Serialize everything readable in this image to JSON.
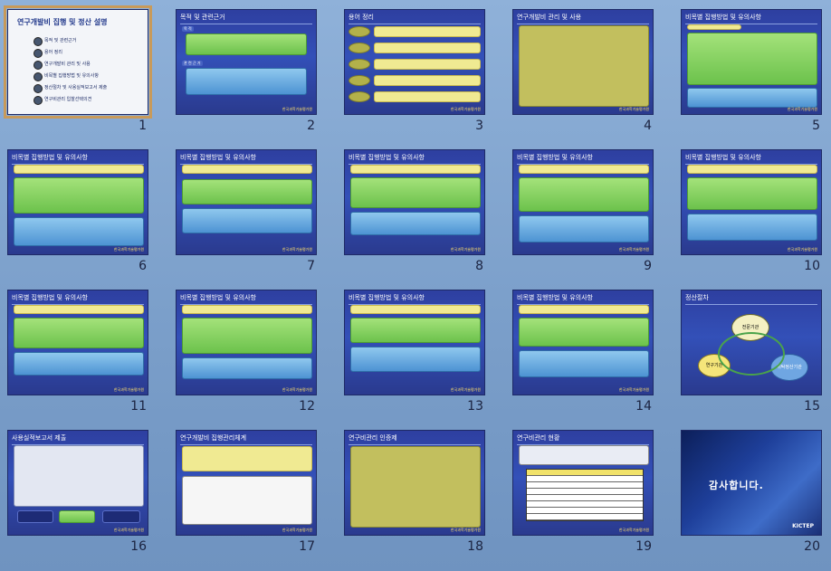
{
  "footer_text": "한국과학기술평가원",
  "slides": [
    {
      "number": "1",
      "title": "연구개발비 집행 및 정산 설명",
      "items": [
        "목적 및 관련근거",
        "용어 정리",
        "연구개발비 관리 및 사용",
        "비목별 집행방법 및 유의사항",
        "정산절차 및 사용실적보고서 제출",
        "연구비관리 입찰선택의견"
      ]
    },
    {
      "number": "2",
      "title": "목적 및 관련근거",
      "heading1": "목 적",
      "heading2": "관 련 근 거"
    },
    {
      "number": "3",
      "title": "용어 정리"
    },
    {
      "number": "4",
      "title": "연구개발비 관리 및 사용"
    },
    {
      "number": "5",
      "title": "비목별 집행방법 및 유의사항"
    },
    {
      "number": "6",
      "title": "비목별 집행방법 및 유의사항"
    },
    {
      "number": "7",
      "title": "비목별 집행방법 및 유의사항"
    },
    {
      "number": "8",
      "title": "비목별 집행방법 및 유의사항"
    },
    {
      "number": "9",
      "title": "비목별 집행방법 및 유의사항"
    },
    {
      "number": "10",
      "title": "비목별 집행방법 및 유의사항"
    },
    {
      "number": "11",
      "title": "비목별 집행방법 및 유의사항"
    },
    {
      "number": "12",
      "title": "비목별 집행방법 및 유의사항"
    },
    {
      "number": "13",
      "title": "비목별 집행방법 및 유의사항"
    },
    {
      "number": "14",
      "title": "비목별 집행방법 및 유의사항"
    },
    {
      "number": "15",
      "title": "정산절차",
      "nodes": [
        "전문기관",
        "연구기관",
        "위탁정산기관"
      ]
    },
    {
      "number": "16",
      "title": "사용실적보고서 제출"
    },
    {
      "number": "17",
      "title": "연구개발비 집행관리체계"
    },
    {
      "number": "18",
      "title": "연구비관리 인증제"
    },
    {
      "number": "19",
      "title": "연구비관리 현황"
    },
    {
      "number": "20",
      "title": "감사합니다.",
      "logo": "KICTEP"
    }
  ]
}
